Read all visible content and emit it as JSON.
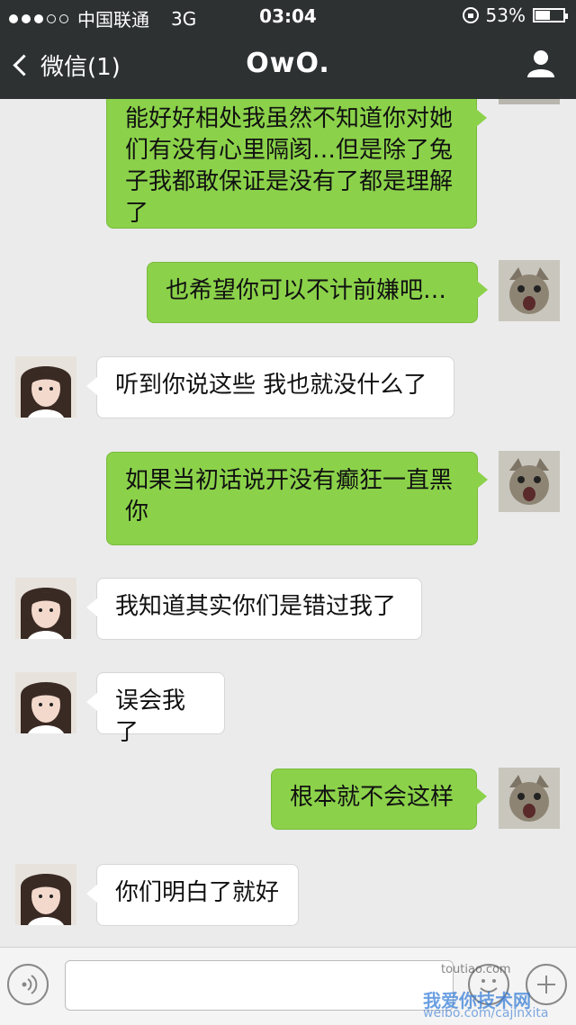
{
  "status_bar": {
    "carrier": "中国联通",
    "network": "3G",
    "time": "03:04",
    "battery": "53%",
    "battery_level": 0.53
  },
  "nav": {
    "back_label": "微信(1)",
    "title": "OwO.",
    "profile_icon": "person-icon"
  },
  "messages": [
    {
      "from": "me",
      "text": "能好好相处我虽然不知道你对她们有没有心里隔阂…但是除了兔子我都敢保证是没有了都是理解了"
    },
    {
      "from": "me",
      "text": "也希望你可以不计前嫌吧…"
    },
    {
      "from": "her",
      "text": "听到你说这些 我也就没什么了"
    },
    {
      "from": "me",
      "text": "如果当初话说开没有癫狂一直黑你"
    },
    {
      "from": "her",
      "text": "我知道其实你们是错过我了"
    },
    {
      "from": "her",
      "text": "误会我了"
    },
    {
      "from": "me",
      "text": "根本就不会这样"
    },
    {
      "from": "her",
      "text": "你们明白了就好"
    }
  ],
  "input_bar": {
    "voice_icon": "voice-icon",
    "emoji_icon": "emoji-icon",
    "plus_icon": "plus-icon"
  },
  "watermark": {
    "line1": "toutiao.com",
    "line2": "我爱你技术网",
    "line3": "weibo.com/cajinxita"
  },
  "colors": {
    "header_bg": "#2e3132",
    "my_bubble": "#8bd24a",
    "her_bubble": "#ffffff",
    "chat_bg": "#ebebeb"
  }
}
